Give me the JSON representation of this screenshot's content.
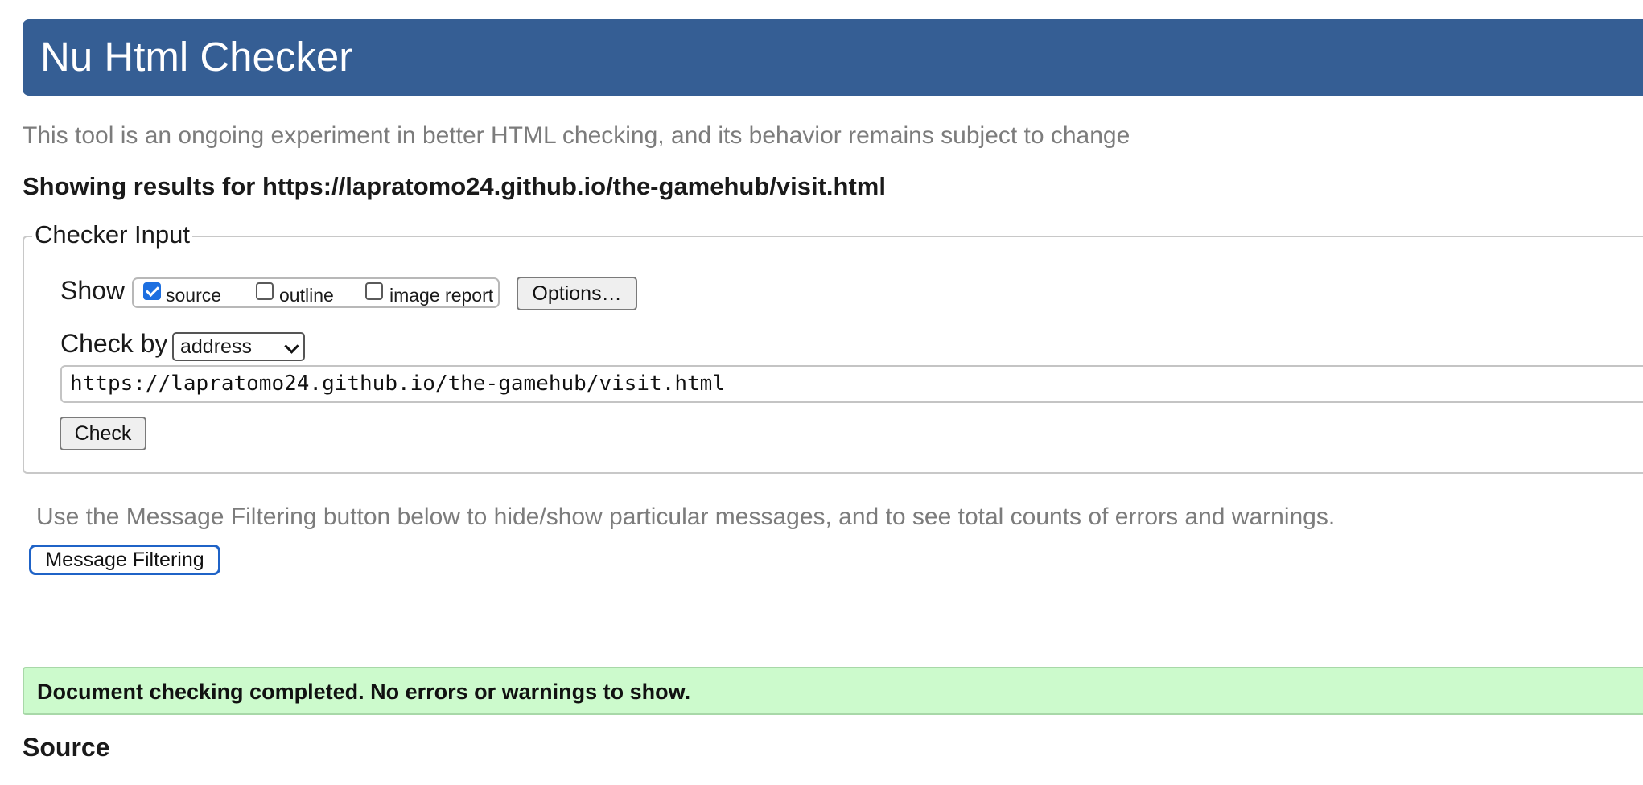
{
  "header": {
    "title": "Nu Html Checker",
    "background_color": "#355e94"
  },
  "intro": {
    "text": "This tool is an ongoing experiment in better HTML checking, and its behavior remains subject to change"
  },
  "results": {
    "heading_prefix": "Showing results for ",
    "url": "https://lapratomo24.github.io/the-gamehub/visit.html"
  },
  "checker_input": {
    "legend": "Checker Input",
    "show_label": "Show",
    "show_options": [
      {
        "label": "source",
        "checked": true
      },
      {
        "label": "outline",
        "checked": false
      },
      {
        "label": "image report",
        "checked": false
      }
    ],
    "options_button": "Options…",
    "check_by_label": "Check by",
    "check_by_selected": "address",
    "url_value": "https://lapratomo24.github.io/the-gamehub/visit.html",
    "check_button": "Check"
  },
  "filtering": {
    "note": "Use the Message Filtering button below to hide/show particular messages, and to see total counts of errors and warnings.",
    "button": "Message Filtering"
  },
  "status": {
    "message": "Document checking completed. No errors or warnings to show.",
    "color": "#ccfacc"
  },
  "source": {
    "heading": "Source"
  }
}
